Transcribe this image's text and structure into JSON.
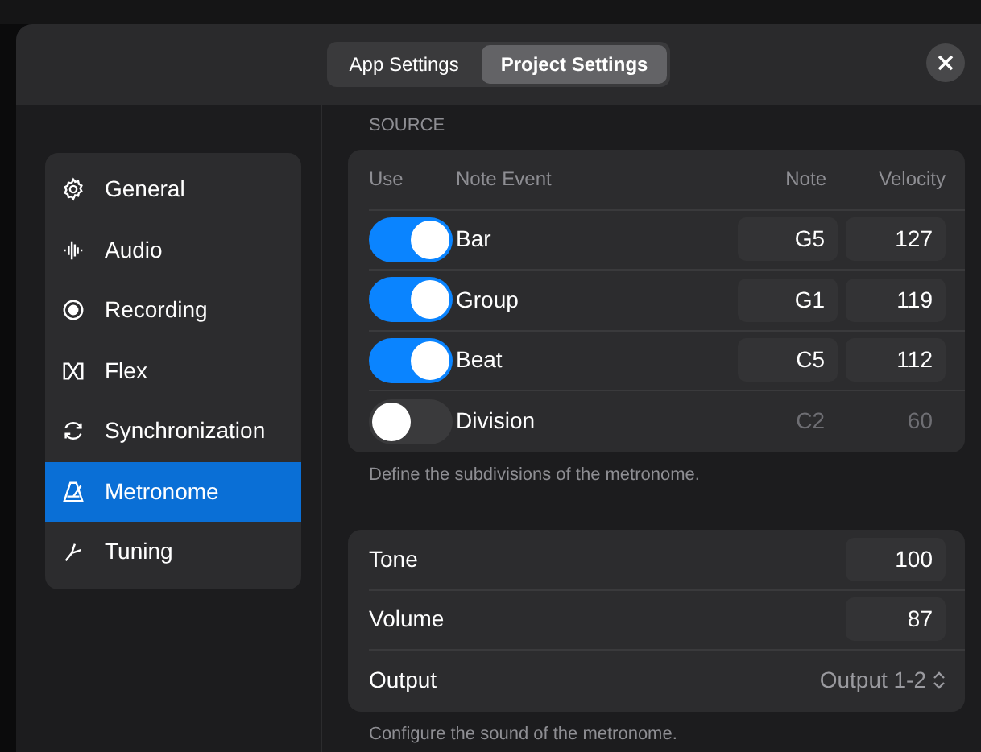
{
  "tabs": [
    {
      "label": "App Settings",
      "selected": false
    },
    {
      "label": "Project Settings",
      "selected": true
    }
  ],
  "sidebar": {
    "items": [
      {
        "label": "General",
        "kind": "gear",
        "selected": false
      },
      {
        "label": "Audio",
        "kind": "waveform",
        "selected": false
      },
      {
        "label": "Recording",
        "kind": "record",
        "selected": false
      },
      {
        "label": "Flex",
        "kind": "flex",
        "selected": false
      },
      {
        "label": "Synchronization",
        "kind": "sync",
        "selected": false
      },
      {
        "label": "Metronome",
        "kind": "metronome",
        "selected": true
      },
      {
        "label": "Tuning",
        "kind": "fork",
        "selected": false
      }
    ]
  },
  "source": {
    "heading": "SOURCE",
    "columns": [
      "Use",
      "Note Event",
      "Note",
      "Velocity"
    ],
    "rows": [
      {
        "on": true,
        "event": "Bar",
        "note": "G5",
        "velocity": "127"
      },
      {
        "on": true,
        "event": "Group",
        "note": "G1",
        "velocity": "119"
      },
      {
        "on": true,
        "event": "Beat",
        "note": "C5",
        "velocity": "112"
      },
      {
        "on": false,
        "event": "Division",
        "note": "C2",
        "velocity": "60"
      }
    ],
    "footnote": "Define the subdivisions of the metronome."
  },
  "sound": {
    "rows": [
      {
        "kind": "field",
        "label": "Tone",
        "value": "100"
      },
      {
        "kind": "field",
        "label": "Volume",
        "value": "87"
      },
      {
        "kind": "select",
        "label": "Output",
        "value": "Output 1-2"
      }
    ],
    "footnote": "Configure the sound of the metronome."
  }
}
